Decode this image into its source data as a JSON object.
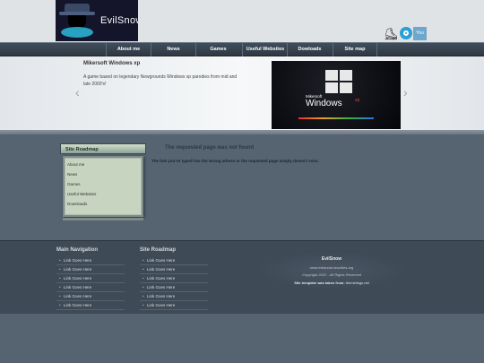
{
  "logo": {
    "text": "EvilSnow"
  },
  "social": {
    "icons": [
      "roller-skater-icon",
      "social-bird-icon",
      "youtube-icon"
    ],
    "youtube_text": "You Tube"
  },
  "nav": {
    "items": [
      "About me",
      "News",
      "Games",
      "Useful Websites",
      "Dowloads",
      "Site map"
    ]
  },
  "slider": {
    "title": "Mikersoft Windows xp",
    "description": "A game based on legendary Newgrounds Windows xp parodies from mid and late 2000's!",
    "image": {
      "line1": "Mikersoft",
      "line2": "Windows",
      "line3": "xp"
    }
  },
  "roadmap": {
    "title": "Site Roadmap",
    "items": [
      "About me",
      "News",
      "Games",
      "Useful Websites",
      "Downloads"
    ]
  },
  "error": {
    "title": "The requested page was not found",
    "message": "The link you've typed has the wrong adress or the requested page simply doesn't exist."
  },
  "footer": {
    "nav_title": "Main Navigation",
    "roadmap_title": "Site Roadmap",
    "nav_links": [
      "Link Goes Here",
      "Link Goes Here",
      "Link Goes Here",
      "Link Goes Here",
      "Link Goes Here",
      "Link Goes Here"
    ],
    "roadmap_links": [
      "Link Goes Here",
      "Link Goes Here",
      "Link Goes Here",
      "Link Goes Here",
      "Link Goes Here",
      "Link Goes Here"
    ],
    "site_name": "EvilSnow",
    "site_url": "www.evilsnow.neocities.org",
    "copyright": "Copyright 2022 - All Rights Reserved",
    "template_label": "Site template was taken from:",
    "template_source": "themelings.net"
  }
}
